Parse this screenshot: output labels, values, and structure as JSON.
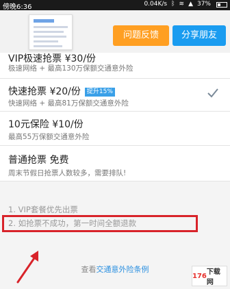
{
  "status_bar": {
    "time": "傍晚6:36",
    "network_speed": "0.04K/s",
    "battery": "37%"
  },
  "top": {
    "feedback_button": "问题反馈",
    "share_button": "分享朋友"
  },
  "options": [
    {
      "title": "VIP极速抢票 ¥30/份",
      "tag": "",
      "desc": "极速网络 + 最高130万保额交通意外险"
    },
    {
      "title": "快速抢票 ¥20/份",
      "tag": "提升15%",
      "desc": "快速网络 + 最高81万保额交通意外险",
      "selected": true
    },
    {
      "title": "10元保险 ¥10/份",
      "tag": "",
      "desc": "最高55万保额交通意外险"
    },
    {
      "title": "普通抢票 免费",
      "tag": "",
      "desc": "周末节假日抢票人数较多，需要排队!"
    }
  ],
  "notes": [
    "1. VIP套餐优先出票",
    "2. 如抢票不成功，第一时间全额退款"
  ],
  "footer": {
    "prefix": "查看",
    "link": "交通意外险条例"
  },
  "watermark": {
    "number": "176",
    "text": "下载网"
  }
}
